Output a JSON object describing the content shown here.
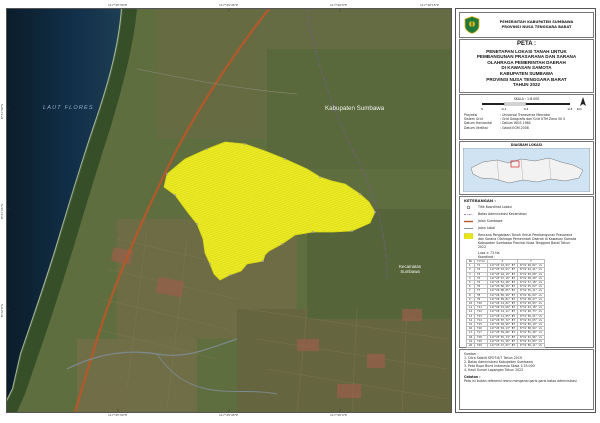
{
  "header": {
    "institution_line_1": "PEMERINTAH KABUPATEN SUMBAWA",
    "institution_line_2": "PROVINSI NUSA TENGGARA BARAT"
  },
  "title": {
    "label": "PETA :",
    "lines": [
      "PENETAPAN LOKASI TANAH UNTUK",
      "PEMBANGUNAN PRASARANA DAN SARANA",
      "OLAHRAGA PEMERINTAH DAERAH",
      "DI KAWASAN SAMOTA",
      "KABUPATEN SUMBAWA",
      "PROVINSI NUSA TENGGARA BARAT",
      "TAHUN 2022"
    ]
  },
  "scale": {
    "label": "SKALA : 1:8.000",
    "ticks": [
      "0",
      "0,1",
      "0,2",
      "0,4"
    ],
    "unit": "Km"
  },
  "specs": [
    {
      "key": "Proyeksi",
      "value": ": Universal Transverse Mercator"
    },
    {
      "key": "Sistem Grid",
      "value": ": Grid Geografis dan Grid UTM Zona 50 S"
    },
    {
      "key": "Datum Horizontal",
      "value": ": Datum WGS 1984"
    },
    {
      "key": "Datum Vertikal",
      "value": ": Geoid EGM 2008"
    }
  ],
  "inset": {
    "title": "DIAGRAM LOKASI"
  },
  "map_labels": {
    "sea": "LAUT FLORES",
    "regency": "Kabupaten Sumbawa",
    "district_line_1": "Kecamatan",
    "district_line_2": "Sumbawa"
  },
  "legend": {
    "title": "KETERANGAN :",
    "items": [
      {
        "symbol": "point",
        "label": "Titik Koordinat Lokasi"
      },
      {
        "symbol": "admin-boundary",
        "label": "Batas Administrasi Kecamatan"
      },
      {
        "symbol": "road",
        "label": "Jalan Sumbawa"
      },
      {
        "symbol": "local-road",
        "label": "Jalan Lokal"
      },
      {
        "symbol": "area",
        "label": "Rencana Pengadaan Tanah Untuk Pembangunan Prasarana dan Sarana Olahraga Pemerintah Daerah di Kawasan Samota Kabupaten Sumbawa Provinsi Nusa Tenggara Barat Tahun 2022"
      }
    ],
    "area_note": "Luas ± 73 Ha",
    "coord_caption": "Koordinat :"
  },
  "coordinates": {
    "headers": [
      "No",
      "Titik",
      "X",
      "Y"
    ],
    "rows": [
      [
        "1",
        "T1",
        "117°25'43,93\" BT",
        "8°31'48,82\" LS"
      ],
      [
        "2",
        "T2",
        "117°25'43,61\" BT",
        "8°31'44,21\" LS"
      ],
      [
        "3",
        "T3",
        "117°25'44,19\" BT",
        "8°31'40,08\" LS"
      ],
      [
        "4",
        "T4",
        "117°25'47,10\" BT",
        "8°31'38,40\" LS"
      ],
      [
        "5",
        "T5",
        "117°25'51,48\" BT",
        "8°31'37,18\" LS"
      ],
      [
        "6",
        "T6",
        "117°25'56,25\" BT",
        "8°31'35,62\" LS"
      ],
      [
        "7",
        "T7",
        "117°26'00,65\" BT",
        "8°31'35,11\" LS"
      ],
      [
        "8",
        "T8",
        "117°26'05,20\" BT",
        "8°31'36,04\" LS"
      ],
      [
        "9",
        "T9",
        "117°26'09,81\" BT",
        "8°31'38,27\" LS"
      ],
      [
        "10",
        "T10",
        "117°26'14,02\" BT",
        "8°31'39,93\" LS"
      ],
      [
        "11",
        "T11",
        "117°26'15,60\" BT",
        "8°31'43,18\" LS"
      ],
      [
        "12",
        "T12",
        "117°26'14,11\" BT",
        "8°31'46,73\" LS"
      ],
      [
        "13",
        "T13",
        "117°26'11,05\" BT",
        "8°31'50,21\" LS"
      ],
      [
        "14",
        "T14",
        "117°26'07,72\" BT",
        "8°31'53,65\" LS"
      ],
      [
        "15",
        "T15",
        "117°26'04,90\" BT",
        "8°31'56,19\" LS"
      ],
      [
        "16",
        "T16",
        "117°26'02,13\" BT",
        "8°31'58,94\" LS"
      ],
      [
        "17",
        "T17",
        "117°25'59,08\" BT",
        "8°31'55,40\" LS"
      ],
      [
        "18",
        "T18",
        "117°25'55,74\" BT",
        "8°31'52,96\" LS"
      ],
      [
        "19",
        "T19",
        "117°25'51,20\" BT",
        "8°31'51,83\" LS"
      ],
      [
        "20",
        "T20",
        "117°25'47,02\" BT",
        "8°31'50,11\" LS"
      ]
    ]
  },
  "sources": {
    "lines": [
      "Sumber :",
      "1. Citra Satelit SPOT-6/7 Tahun 2019",
      "2. Batas Administrasi Kabupaten Sumbawa",
      "3. Peta Rupa Bumi Indonesia Skala 1:25.000",
      "4. Hasil Survei Lapangan Tahun 2022"
    ],
    "note": "Catatan :",
    "note_text": "Peta ini bukan referensi resmi mengenai garis-garis batas administrasi"
  },
  "grid_ticks": {
    "top": [
      "117°25'30\"E",
      "117°25'45\"E",
      "117°26'0\"E",
      "117°26'15\"E"
    ],
    "left": [
      "8°31'30\"S",
      "8°31'45\"S",
      "8°32'0\"S"
    ]
  },
  "colors": {
    "land": "#5d6b3f",
    "sea": "#0f2636",
    "parcel": "#e9e61c",
    "road": "#b5582a",
    "logo_green": "#1f7a3a",
    "logo_gold": "#e3b31b"
  }
}
